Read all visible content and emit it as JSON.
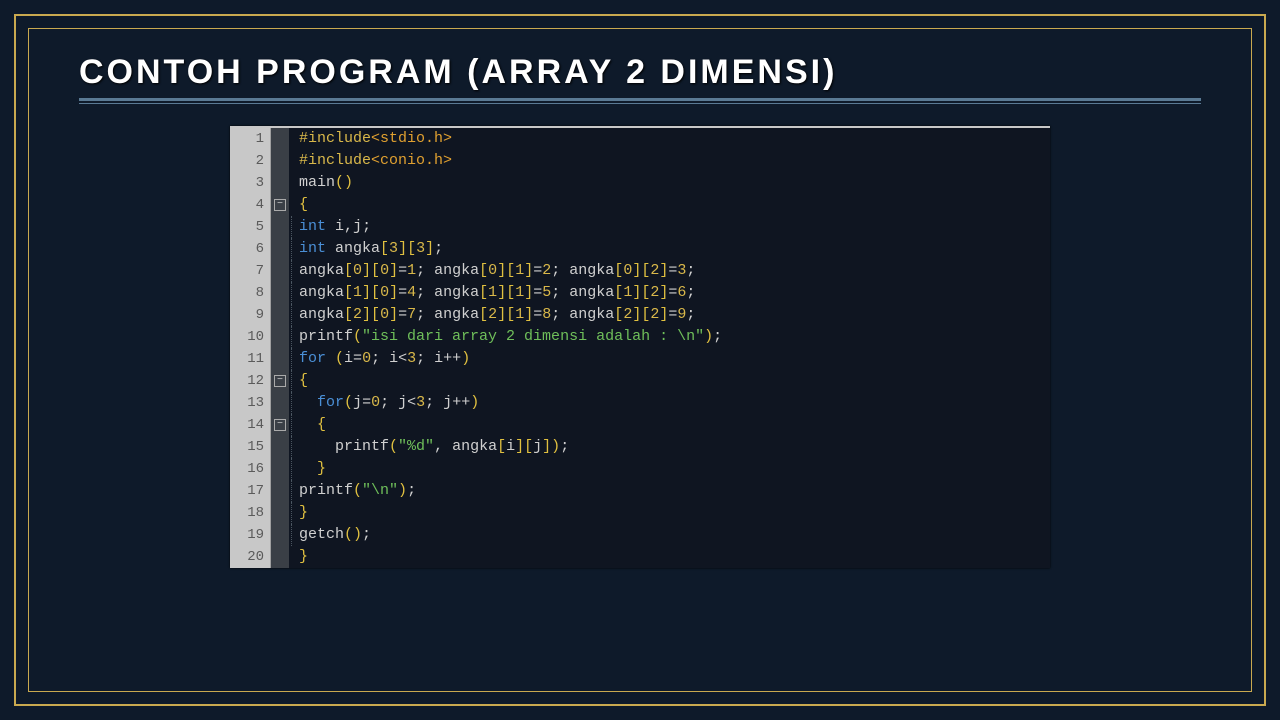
{
  "title": "CONTOH PROGRAM (ARRAY 2 DIMENSI)",
  "code": {
    "lines": [
      {
        "n": 1,
        "fold": "",
        "indent": 0,
        "tokens": [
          {
            "t": "#include",
            "c": "c-pre"
          },
          {
            "t": "<stdio.h>",
            "c": "c-inc"
          }
        ]
      },
      {
        "n": 2,
        "fold": "",
        "indent": 0,
        "tokens": [
          {
            "t": "#include",
            "c": "c-pre"
          },
          {
            "t": "<conio.h>",
            "c": "c-inc"
          }
        ]
      },
      {
        "n": 3,
        "fold": "",
        "indent": 0,
        "tokens": [
          {
            "t": "main",
            "c": "c-fn"
          },
          {
            "t": "()",
            "c": "c-br"
          }
        ]
      },
      {
        "n": 4,
        "fold": "box",
        "indent": 0,
        "tokens": [
          {
            "t": "{",
            "c": "c-br"
          }
        ]
      },
      {
        "n": 5,
        "fold": "",
        "indent": 0,
        "tokens": [
          {
            "t": "int ",
            "c": "c-kw"
          },
          {
            "t": "i",
            "c": "c-punc"
          },
          {
            "t": ",",
            "c": "c-punc"
          },
          {
            "t": "j",
            "c": "c-punc"
          },
          {
            "t": ";",
            "c": "c-punc"
          }
        ]
      },
      {
        "n": 6,
        "fold": "",
        "indent": 0,
        "tokens": [
          {
            "t": "int ",
            "c": "c-kw"
          },
          {
            "t": "angka",
            "c": "c-punc"
          },
          {
            "t": "[",
            "c": "c-br"
          },
          {
            "t": "3",
            "c": "c-num"
          },
          {
            "t": "][",
            "c": "c-br"
          },
          {
            "t": "3",
            "c": "c-num"
          },
          {
            "t": "]",
            "c": "c-br"
          },
          {
            "t": ";",
            "c": "c-punc"
          }
        ]
      },
      {
        "n": 7,
        "fold": "",
        "indent": 0,
        "tokens": [
          {
            "t": "angka",
            "c": "c-punc"
          },
          {
            "t": "[",
            "c": "c-br"
          },
          {
            "t": "0",
            "c": "c-num"
          },
          {
            "t": "][",
            "c": "c-br"
          },
          {
            "t": "0",
            "c": "c-num"
          },
          {
            "t": "]",
            "c": "c-br"
          },
          {
            "t": "=",
            "c": "c-op"
          },
          {
            "t": "1",
            "c": "c-num"
          },
          {
            "t": "; ",
            "c": "c-punc"
          },
          {
            "t": "angka",
            "c": "c-punc"
          },
          {
            "t": "[",
            "c": "c-br"
          },
          {
            "t": "0",
            "c": "c-num"
          },
          {
            "t": "][",
            "c": "c-br"
          },
          {
            "t": "1",
            "c": "c-num"
          },
          {
            "t": "]",
            "c": "c-br"
          },
          {
            "t": "=",
            "c": "c-op"
          },
          {
            "t": "2",
            "c": "c-num"
          },
          {
            "t": "; ",
            "c": "c-punc"
          },
          {
            "t": "angka",
            "c": "c-punc"
          },
          {
            "t": "[",
            "c": "c-br"
          },
          {
            "t": "0",
            "c": "c-num"
          },
          {
            "t": "][",
            "c": "c-br"
          },
          {
            "t": "2",
            "c": "c-num"
          },
          {
            "t": "]",
            "c": "c-br"
          },
          {
            "t": "=",
            "c": "c-op"
          },
          {
            "t": "3",
            "c": "c-num"
          },
          {
            "t": ";",
            "c": "c-punc"
          }
        ]
      },
      {
        "n": 8,
        "fold": "",
        "indent": 0,
        "tokens": [
          {
            "t": "angka",
            "c": "c-punc"
          },
          {
            "t": "[",
            "c": "c-br"
          },
          {
            "t": "1",
            "c": "c-num"
          },
          {
            "t": "][",
            "c": "c-br"
          },
          {
            "t": "0",
            "c": "c-num"
          },
          {
            "t": "]",
            "c": "c-br"
          },
          {
            "t": "=",
            "c": "c-op"
          },
          {
            "t": "4",
            "c": "c-num"
          },
          {
            "t": "; ",
            "c": "c-punc"
          },
          {
            "t": "angka",
            "c": "c-punc"
          },
          {
            "t": "[",
            "c": "c-br"
          },
          {
            "t": "1",
            "c": "c-num"
          },
          {
            "t": "][",
            "c": "c-br"
          },
          {
            "t": "1",
            "c": "c-num"
          },
          {
            "t": "]",
            "c": "c-br"
          },
          {
            "t": "=",
            "c": "c-op"
          },
          {
            "t": "5",
            "c": "c-num"
          },
          {
            "t": "; ",
            "c": "c-punc"
          },
          {
            "t": "angka",
            "c": "c-punc"
          },
          {
            "t": "[",
            "c": "c-br"
          },
          {
            "t": "1",
            "c": "c-num"
          },
          {
            "t": "][",
            "c": "c-br"
          },
          {
            "t": "2",
            "c": "c-num"
          },
          {
            "t": "]",
            "c": "c-br"
          },
          {
            "t": "=",
            "c": "c-op"
          },
          {
            "t": "6",
            "c": "c-num"
          },
          {
            "t": ";",
            "c": "c-punc"
          }
        ]
      },
      {
        "n": 9,
        "fold": "",
        "indent": 0,
        "tokens": [
          {
            "t": "angka",
            "c": "c-punc"
          },
          {
            "t": "[",
            "c": "c-br"
          },
          {
            "t": "2",
            "c": "c-num"
          },
          {
            "t": "][",
            "c": "c-br"
          },
          {
            "t": "0",
            "c": "c-num"
          },
          {
            "t": "]",
            "c": "c-br"
          },
          {
            "t": "=",
            "c": "c-op"
          },
          {
            "t": "7",
            "c": "c-num"
          },
          {
            "t": "; ",
            "c": "c-punc"
          },
          {
            "t": "angka",
            "c": "c-punc"
          },
          {
            "t": "[",
            "c": "c-br"
          },
          {
            "t": "2",
            "c": "c-num"
          },
          {
            "t": "][",
            "c": "c-br"
          },
          {
            "t": "1",
            "c": "c-num"
          },
          {
            "t": "]",
            "c": "c-br"
          },
          {
            "t": "=",
            "c": "c-op"
          },
          {
            "t": "8",
            "c": "c-num"
          },
          {
            "t": "; ",
            "c": "c-punc"
          },
          {
            "t": "angka",
            "c": "c-punc"
          },
          {
            "t": "[",
            "c": "c-br"
          },
          {
            "t": "2",
            "c": "c-num"
          },
          {
            "t": "][",
            "c": "c-br"
          },
          {
            "t": "2",
            "c": "c-num"
          },
          {
            "t": "]",
            "c": "c-br"
          },
          {
            "t": "=",
            "c": "c-op"
          },
          {
            "t": "9",
            "c": "c-num"
          },
          {
            "t": ";",
            "c": "c-punc"
          }
        ]
      },
      {
        "n": 10,
        "fold": "",
        "indent": 0,
        "tokens": [
          {
            "t": "printf",
            "c": "c-fn"
          },
          {
            "t": "(",
            "c": "c-br"
          },
          {
            "t": "\"isi dari array 2 dimensi adalah : \\n\"",
            "c": "c-str"
          },
          {
            "t": ")",
            "c": "c-br"
          },
          {
            "t": ";",
            "c": "c-punc"
          }
        ]
      },
      {
        "n": 11,
        "fold": "",
        "indent": 0,
        "tokens": [
          {
            "t": "for ",
            "c": "c-kw"
          },
          {
            "t": "(",
            "c": "c-br"
          },
          {
            "t": "i",
            "c": "c-punc"
          },
          {
            "t": "=",
            "c": "c-op"
          },
          {
            "t": "0",
            "c": "c-num"
          },
          {
            "t": "; ",
            "c": "c-punc"
          },
          {
            "t": "i",
            "c": "c-punc"
          },
          {
            "t": "<",
            "c": "c-op"
          },
          {
            "t": "3",
            "c": "c-num"
          },
          {
            "t": "; ",
            "c": "c-punc"
          },
          {
            "t": "i",
            "c": "c-punc"
          },
          {
            "t": "++",
            "c": "c-op"
          },
          {
            "t": ")",
            "c": "c-br"
          }
        ]
      },
      {
        "n": 12,
        "fold": "box",
        "indent": 0,
        "tokens": [
          {
            "t": "{",
            "c": "c-br"
          }
        ]
      },
      {
        "n": 13,
        "fold": "",
        "indent": 1,
        "tokens": [
          {
            "t": "for",
            "c": "c-kw"
          },
          {
            "t": "(",
            "c": "c-br"
          },
          {
            "t": "j",
            "c": "c-punc"
          },
          {
            "t": "=",
            "c": "c-op"
          },
          {
            "t": "0",
            "c": "c-num"
          },
          {
            "t": "; ",
            "c": "c-punc"
          },
          {
            "t": "j",
            "c": "c-punc"
          },
          {
            "t": "<",
            "c": "c-op"
          },
          {
            "t": "3",
            "c": "c-num"
          },
          {
            "t": "; ",
            "c": "c-punc"
          },
          {
            "t": "j",
            "c": "c-punc"
          },
          {
            "t": "++",
            "c": "c-op"
          },
          {
            "t": ")",
            "c": "c-br"
          }
        ]
      },
      {
        "n": 14,
        "fold": "box",
        "indent": 1,
        "tokens": [
          {
            "t": "{",
            "c": "c-br"
          }
        ]
      },
      {
        "n": 15,
        "fold": "",
        "indent": 2,
        "tokens": [
          {
            "t": "printf",
            "c": "c-fn"
          },
          {
            "t": "(",
            "c": "c-br"
          },
          {
            "t": "\"%d\"",
            "c": "c-str"
          },
          {
            "t": ", ",
            "c": "c-punc"
          },
          {
            "t": "angka",
            "c": "c-punc"
          },
          {
            "t": "[",
            "c": "c-br"
          },
          {
            "t": "i",
            "c": "c-punc"
          },
          {
            "t": "][",
            "c": "c-br"
          },
          {
            "t": "j",
            "c": "c-punc"
          },
          {
            "t": "]",
            "c": "c-br"
          },
          {
            "t": ")",
            "c": "c-br"
          },
          {
            "t": ";",
            "c": "c-punc"
          }
        ]
      },
      {
        "n": 16,
        "fold": "",
        "indent": 1,
        "tokens": [
          {
            "t": "}",
            "c": "c-br"
          }
        ]
      },
      {
        "n": 17,
        "fold": "",
        "indent": 0,
        "tokens": [
          {
            "t": "printf",
            "c": "c-fn"
          },
          {
            "t": "(",
            "c": "c-br"
          },
          {
            "t": "\"\\n\"",
            "c": "c-str"
          },
          {
            "t": ")",
            "c": "c-br"
          },
          {
            "t": ";",
            "c": "c-punc"
          }
        ]
      },
      {
        "n": 18,
        "fold": "",
        "indent": 0,
        "tokens": [
          {
            "t": "}",
            "c": "c-br"
          }
        ]
      },
      {
        "n": 19,
        "fold": "",
        "indent": 0,
        "tokens": [
          {
            "t": "getch",
            "c": "c-fn"
          },
          {
            "t": "()",
            "c": "c-br"
          },
          {
            "t": ";",
            "c": "c-punc"
          }
        ]
      },
      {
        "n": 20,
        "fold": "",
        "indent": 0,
        "tokens": [
          {
            "t": "}",
            "c": "c-br"
          }
        ]
      }
    ]
  }
}
